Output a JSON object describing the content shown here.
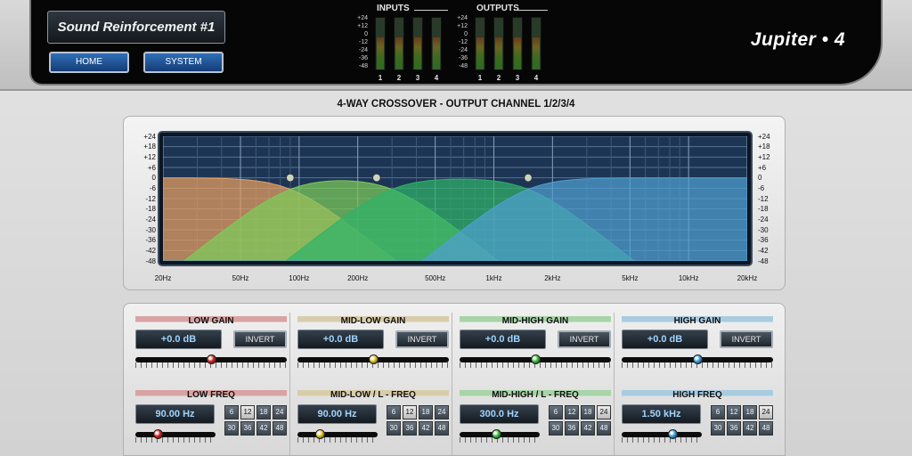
{
  "header": {
    "preset_name": "Sound Reinforcement #1",
    "buttons": {
      "home": "HOME",
      "system": "SYSTEM"
    },
    "brand": "Jupiter • 4",
    "meter_scale": [
      "+24",
      "+12",
      "0",
      "-12",
      "-24",
      "-36",
      "-48"
    ],
    "inputs": {
      "title": "INPUTS",
      "channels": [
        "1",
        "2",
        "3",
        "4"
      ],
      "levels": [
        0.62,
        0.62,
        0.62,
        0.62
      ]
    },
    "outputs": {
      "title": "OUTPUTS",
      "channels": [
        "1",
        "2",
        "3",
        "4"
      ],
      "levels": [
        0.62,
        0.62,
        0.62,
        0.62
      ]
    }
  },
  "section_title": "4-WAY CROSSOVER - OUTPUT CHANNEL 1/2/3/4",
  "graph": {
    "db_labels": [
      "+24",
      "+18",
      "+12",
      "+6",
      "0",
      "-6",
      "-12",
      "-18",
      "-24",
      "-30",
      "-36",
      "-42",
      "-48"
    ],
    "db_range": [
      -48,
      24
    ],
    "freq_range_hz": [
      20,
      20000
    ],
    "freq_labels": [
      {
        "label": "20Hz",
        "hz": 20
      },
      {
        "label": "50Hz",
        "hz": 50
      },
      {
        "label": "100Hz",
        "hz": 100
      },
      {
        "label": "200Hz",
        "hz": 200
      },
      {
        "label": "500Hz",
        "hz": 500
      },
      {
        "label": "1kHz",
        "hz": 1000
      },
      {
        "label": "2kHz",
        "hz": 2000
      },
      {
        "label": "5kHz",
        "hz": 5000
      },
      {
        "label": "10kHz",
        "hz": 10000
      },
      {
        "label": "20kHz",
        "hz": 20000
      }
    ],
    "bands": [
      {
        "name": "low",
        "color": "#e8a060",
        "hp_hz": 20,
        "lp_hz": 90,
        "marker_hz": 90,
        "gain_db": 0
      },
      {
        "name": "mid-low",
        "color": "#7ccc5a",
        "hp_hz": 90,
        "lp_hz": 300,
        "marker_hz": 250,
        "gain_db": 0
      },
      {
        "name": "mid-high",
        "color": "#2fb36a",
        "hp_hz": 300,
        "lp_hz": 1500,
        "marker_hz": 1500,
        "gain_db": 0
      },
      {
        "name": "high",
        "color": "#4f9fd0",
        "hp_hz": 1500,
        "lp_hz": 20000,
        "marker_hz": 1500,
        "gain_db": 0
      }
    ],
    "markers_hz": [
      90,
      250,
      1500
    ]
  },
  "controls": {
    "invert_label": "INVERT",
    "slope_options": [
      "6",
      "12",
      "18",
      "24",
      "30",
      "36",
      "42",
      "48"
    ],
    "bands": [
      {
        "gain_label": "LOW GAIN",
        "gain_value": "+0.0 dB",
        "freq_label": "LOW FREQ",
        "freq_value": "90.00 Hz",
        "header_color": "#d9a3a3",
        "knob_color": "#d62020",
        "gain_level": 0.5,
        "freq_level": 0.25,
        "active_slope": "12"
      },
      {
        "gain_label": "MID-LOW GAIN",
        "gain_value": "+0.0 dB",
        "freq_label": "MID-LOW / L - FREQ",
        "freq_value": "90.00 Hz",
        "header_color": "#d8ccaa",
        "knob_color": "#e0c020",
        "gain_level": 0.5,
        "freq_level": 0.25,
        "active_slope": "12"
      },
      {
        "gain_label": "MID-HIGH GAIN",
        "gain_value": "+0.0 dB",
        "freq_label": "MID-HIGH / L - FREQ",
        "freq_value": "300.0 Hz",
        "header_color": "#a8d4a8",
        "knob_color": "#30c030",
        "gain_level": 0.5,
        "freq_level": 0.45,
        "active_slope": "24"
      },
      {
        "gain_label": "HIGH GAIN",
        "gain_value": "+0.0 dB",
        "freq_label": "HIGH FREQ",
        "freq_value": "1.50 kHz",
        "header_color": "#a8cce0",
        "knob_color": "#30a0e0",
        "gain_level": 0.5,
        "freq_level": 0.65,
        "active_slope": "24"
      }
    ]
  }
}
